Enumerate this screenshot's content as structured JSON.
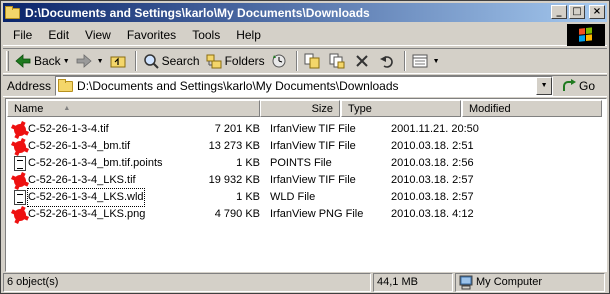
{
  "window": {
    "title": "D:\\Documents and Settings\\karlo\\My Documents\\Downloads",
    "minimize_label": "_",
    "maximize_label": "□",
    "close_label": "×"
  },
  "menu": [
    "File",
    "Edit",
    "View",
    "Favorites",
    "Tools",
    "Help"
  ],
  "toolbar": {
    "back_label": "Back",
    "search_label": "Search",
    "folders_label": "Folders"
  },
  "address": {
    "label": "Address",
    "value": "D:\\Documents and Settings\\karlo\\My Documents\\Downloads",
    "go_label": "Go"
  },
  "list": {
    "columns": [
      "Name",
      "Size",
      "Type",
      "Modified"
    ],
    "rows": [
      {
        "icon": "irfanview-icon",
        "name": "C-52-26-1-3-4.tif",
        "size": "7 201 KB",
        "type": "IrfanView TIF File",
        "modified": "2001.11.21. 20:50"
      },
      {
        "icon": "irfanview-icon",
        "name": "C-52-26-1-3-4_bm.tif",
        "size": "13 273 KB",
        "type": "IrfanView TIF File",
        "modified": "2010.03.18. 2:51"
      },
      {
        "icon": "document-icon",
        "name": "C-52-26-1-3-4_bm.tif.points",
        "size": "1 KB",
        "type": "POINTS File",
        "modified": "2010.03.18. 2:56"
      },
      {
        "icon": "irfanview-icon",
        "name": "C-52-26-1-3-4_LKS.tif",
        "size": "19 932 KB",
        "type": "IrfanView TIF File",
        "modified": "2010.03.18. 2:57"
      },
      {
        "icon": "document-icon",
        "name": "C-52-26-1-3-4_LKS.wld",
        "size": "1 KB",
        "type": "WLD File",
        "modified": "2010.03.18. 2:57"
      },
      {
        "icon": "irfanview-icon",
        "name": "C-52-26-1-3-4_LKS.png",
        "size": "4 790 KB",
        "type": "IrfanView PNG File",
        "modified": "2010.03.18. 4:12"
      }
    ]
  },
  "status": {
    "count": "6 object(s)",
    "size": "44,1 MB",
    "zone": "My Computer"
  },
  "colors": {
    "titlebar_start": "#0a246a",
    "titlebar_end": "#a6caf0",
    "face": "#d4d0c8",
    "irfanview_red": "#e11111"
  }
}
